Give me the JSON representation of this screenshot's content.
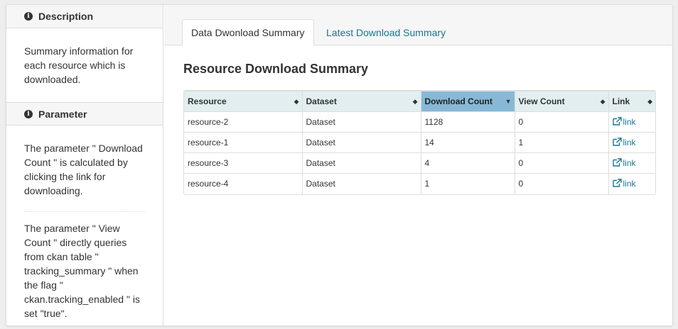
{
  "sidebar": {
    "description": {
      "title": "Description",
      "icon": "info-icon",
      "text": "Summary information for each resource which is downloaded."
    },
    "parameter": {
      "title": "Parameter",
      "icon": "info-icon",
      "text1": "The parameter \" Download Count \" is calculated by clicking the link for downloading.",
      "text2": "The parameter \" View Count \" directly queries from ckan table \" tracking_summary \" when the flag \" ckan.tracking_enabled \" is set \"true\"."
    }
  },
  "tabs": [
    {
      "label": "Data Dwonload Summary",
      "active": true
    },
    {
      "label": "Latest Download Summary",
      "active": false
    }
  ],
  "main": {
    "title": "Resource Download Summary",
    "table": {
      "columns": [
        {
          "label": "Resource",
          "sort": "both"
        },
        {
          "label": "Dataset",
          "sort": "both"
        },
        {
          "label": "Download Count",
          "sort": "desc"
        },
        {
          "label": "View Count",
          "sort": "both"
        },
        {
          "label": "Link",
          "sort": "both"
        }
      ],
      "rows": [
        {
          "resource": "resource-2",
          "dataset": "Dataset",
          "download": "1128",
          "view": "0",
          "link": "link"
        },
        {
          "resource": "resource-1",
          "dataset": "Dataset",
          "download": "14",
          "view": "1",
          "link": "link"
        },
        {
          "resource": "resource-3",
          "dataset": "Dataset",
          "download": "4",
          "view": "0",
          "link": "link"
        },
        {
          "resource": "resource-4",
          "dataset": "Dataset",
          "download": "1",
          "view": "0",
          "link": "link"
        }
      ]
    }
  },
  "colors": {
    "accent_link": "#187794",
    "sorted_header": "#87b9d6",
    "header_bg": "#e3eef0"
  }
}
